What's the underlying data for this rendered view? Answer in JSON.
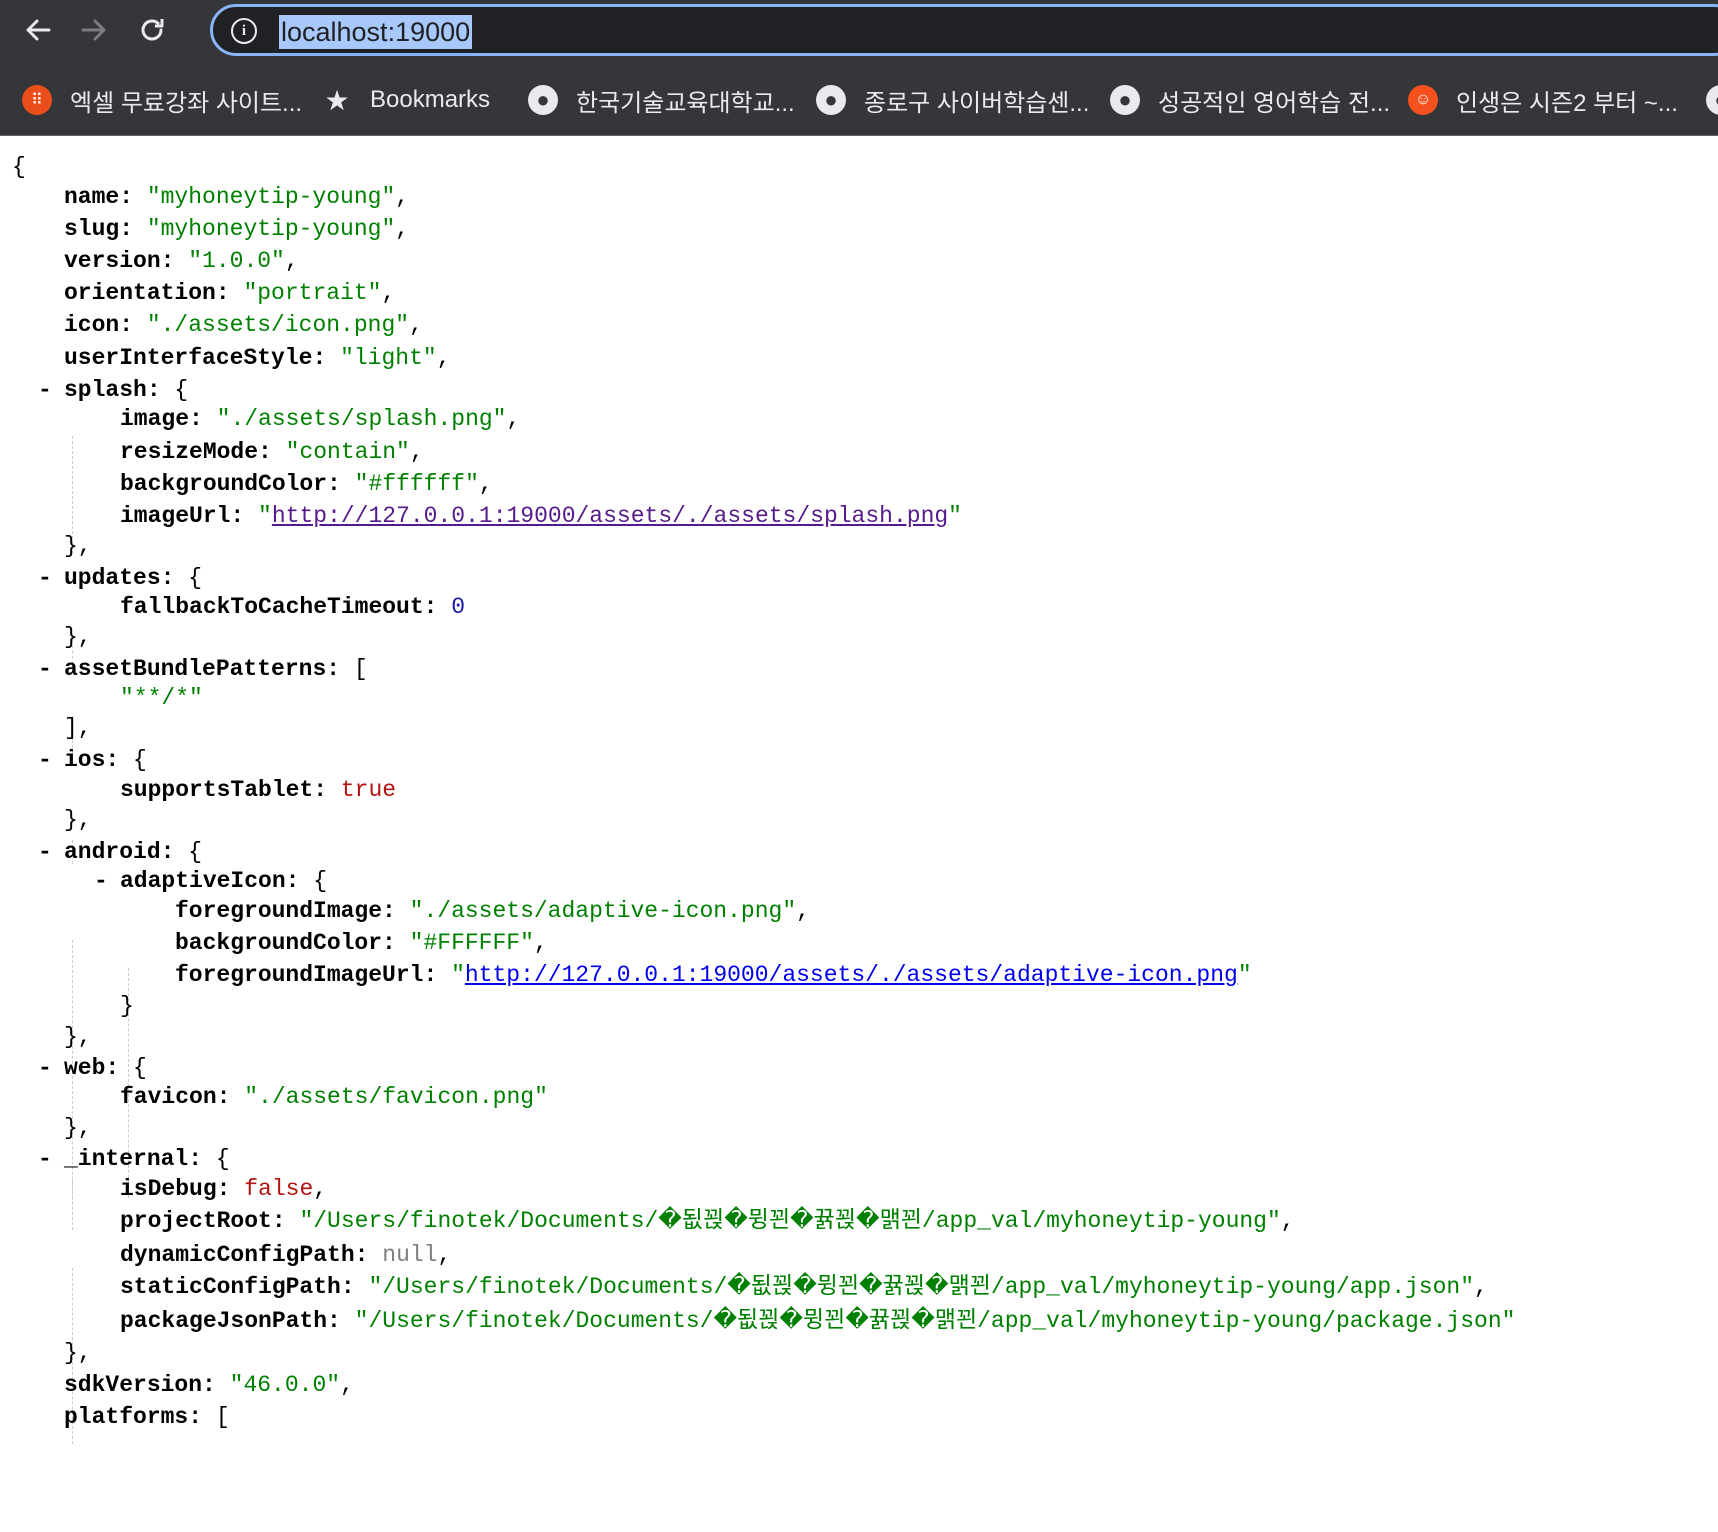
{
  "browser": {
    "back_icon": "arrow-left",
    "forward_icon": "arrow-right",
    "reload_icon": "reload",
    "url": "localhost:19000",
    "bookmarks": [
      {
        "label": "엑셀 무료강좌 사이트...",
        "icon": "orange-grid"
      },
      {
        "label": "Bookmarks",
        "icon": "star"
      },
      {
        "label": "한국기술교육대학교...",
        "icon": "globe"
      },
      {
        "label": "종로구 사이버학습센...",
        "icon": "globe"
      },
      {
        "label": "성공적인 영어학습 전...",
        "icon": "globe"
      },
      {
        "label": "인생은 시즌2 부터 ~...",
        "icon": "red-face"
      }
    ]
  },
  "json": {
    "open_brace": "{",
    "name_key": "name:",
    "name_val": "\"myhoneytip-young\"",
    "slug_key": "slug:",
    "slug_val": "\"myhoneytip-young\"",
    "version_key": "version:",
    "version_val": "\"1.0.0\"",
    "orientation_key": "orientation:",
    "orientation_val": "\"portrait\"",
    "icon_key": "icon:",
    "icon_val": "\"./assets/icon.png\"",
    "uis_key": "userInterfaceStyle:",
    "uis_val": "\"light\"",
    "splash_key": "splash:",
    "image_key": "image:",
    "image_val": "\"./assets/splash.png\"",
    "resize_key": "resizeMode:",
    "resize_val": "\"contain\"",
    "bg_key": "backgroundColor:",
    "bg_val": "\"#ffffff\"",
    "imageurl_key": "imageUrl:",
    "imageurl_val": "http://127.0.0.1:19000/assets/./assets/splash.png",
    "updates_key": "updates:",
    "fallback_key": "fallbackToCacheTimeout:",
    "fallback_val": "0",
    "abp_key": "assetBundlePatterns:",
    "abp_val": "\"**/*\"",
    "ios_key": "ios:",
    "tablet_key": "supportsTablet:",
    "tablet_val": "true",
    "android_key": "android:",
    "adaptive_key": "adaptiveIcon:",
    "fg_key": "foregroundImage:",
    "fg_val": "\"./assets/adaptive-icon.png\"",
    "abg_key": "backgroundColor:",
    "abg_val": "\"#FFFFFF\"",
    "fgurl_key": "foregroundImageUrl:",
    "fgurl_val": "http://127.0.0.1:19000/assets/./assets/adaptive-icon.png",
    "web_key": "web:",
    "favicon_key": "favicon:",
    "favicon_val": "\"./assets/favicon.png\"",
    "internal_key": "_internal:",
    "debug_key": "isDebug:",
    "debug_val": "false",
    "root_key": "projectRoot:",
    "root_val": "\"/Users/finotek/Documents/�됪꾅�뮝꾄�뀱꾅�맭꾄/app_val/myhoneytip-young\"",
    "dcp_key": "dynamicConfigPath:",
    "dcp_val": "null",
    "scp_key": "staticConfigPath:",
    "scp_val": "\"/Users/finotek/Documents/�됪꾅�뮝꾄�뀱꾅�맭꾄/app_val/myhoneytip-young/app.json\"",
    "pjp_key": "packageJsonPath:",
    "pjp_val": "\"/Users/finotek/Documents/�됪꾅�뮝꾄�뀱꾅�맭꾄/app_val/myhoneytip-young/package.json\"",
    "sdk_key": "sdkVersion:",
    "sdk_val": "\"46.0.0\"",
    "platforms_key": "platforms:"
  }
}
